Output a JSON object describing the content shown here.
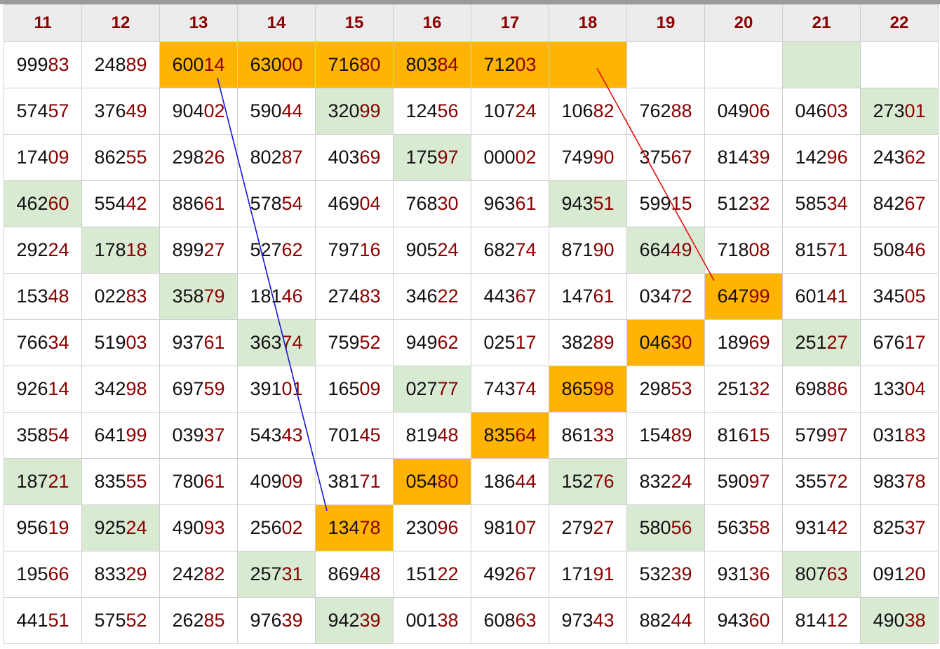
{
  "colors": {
    "header_text": "#8b0000",
    "last_digits": "#8b0000",
    "green_cell": "#d9ead3",
    "orange_cell": "#ffb404",
    "line_blue": "#1515d6",
    "line_red": "#e01010"
  },
  "headers": [
    "11",
    "12",
    "13",
    "14",
    "15",
    "16",
    "17",
    "18",
    "19",
    "20",
    "21",
    "22"
  ],
  "rows": [
    [
      {
        "v": "99983"
      },
      {
        "v": "24889"
      },
      {
        "v": "60014",
        "bg": "orange"
      },
      {
        "v": "63000",
        "bg": "orange"
      },
      {
        "v": "71680",
        "bg": "orange"
      },
      {
        "v": "80384",
        "bg": "orange"
      },
      {
        "v": "71203",
        "bg": "orange"
      },
      {
        "v": "",
        "bg": "orange"
      },
      {
        "v": ""
      },
      {
        "v": ""
      },
      {
        "v": "",
        "bg": "green"
      },
      {
        "v": ""
      }
    ],
    [
      {
        "v": "57457"
      },
      {
        "v": "37649"
      },
      {
        "v": "90402"
      },
      {
        "v": "59044"
      },
      {
        "v": "32099",
        "bg": "green"
      },
      {
        "v": "12456"
      },
      {
        "v": "10724"
      },
      {
        "v": "10682"
      },
      {
        "v": "76288"
      },
      {
        "v": "04906"
      },
      {
        "v": "04603"
      },
      {
        "v": "27301",
        "bg": "green"
      }
    ],
    [
      {
        "v": "17409"
      },
      {
        "v": "86255"
      },
      {
        "v": "29826"
      },
      {
        "v": "80287"
      },
      {
        "v": "40369"
      },
      {
        "v": "17597",
        "bg": "green"
      },
      {
        "v": "00002"
      },
      {
        "v": "74990"
      },
      {
        "v": "37567"
      },
      {
        "v": "81439"
      },
      {
        "v": "14296"
      },
      {
        "v": "24362"
      }
    ],
    [
      {
        "v": "46260",
        "bg": "green"
      },
      {
        "v": "55442"
      },
      {
        "v": "88661"
      },
      {
        "v": "57854"
      },
      {
        "v": "46904"
      },
      {
        "v": "76830"
      },
      {
        "v": "96361"
      },
      {
        "v": "94351",
        "bg": "green"
      },
      {
        "v": "59915"
      },
      {
        "v": "51232"
      },
      {
        "v": "58534"
      },
      {
        "v": "84267"
      }
    ],
    [
      {
        "v": "29224"
      },
      {
        "v": "17818",
        "bg": "green"
      },
      {
        "v": "89927"
      },
      {
        "v": "52762"
      },
      {
        "v": "79716"
      },
      {
        "v": "90524"
      },
      {
        "v": "68274"
      },
      {
        "v": "87190"
      },
      {
        "v": "66449",
        "bg": "green"
      },
      {
        "v": "71808"
      },
      {
        "v": "81571"
      },
      {
        "v": "50846"
      }
    ],
    [
      {
        "v": "15348"
      },
      {
        "v": "02283"
      },
      {
        "v": "35879",
        "bg": "green"
      },
      {
        "v": "18146"
      },
      {
        "v": "27483"
      },
      {
        "v": "34622"
      },
      {
        "v": "44367"
      },
      {
        "v": "14761"
      },
      {
        "v": "03472"
      },
      {
        "v": "64799",
        "bg": "orange"
      },
      {
        "v": "60141"
      },
      {
        "v": "34505"
      }
    ],
    [
      {
        "v": "76634"
      },
      {
        "v": "51903"
      },
      {
        "v": "93761"
      },
      {
        "v": "36374",
        "bg": "green"
      },
      {
        "v": "75952"
      },
      {
        "v": "94962"
      },
      {
        "v": "02517"
      },
      {
        "v": "38289"
      },
      {
        "v": "04630",
        "bg": "orange"
      },
      {
        "v": "18969"
      },
      {
        "v": "25127",
        "bg": "green"
      },
      {
        "v": "67617"
      }
    ],
    [
      {
        "v": "92614"
      },
      {
        "v": "34298"
      },
      {
        "v": "69759"
      },
      {
        "v": "39101"
      },
      {
        "v": "16509"
      },
      {
        "v": "02777",
        "bg": "green"
      },
      {
        "v": "74374"
      },
      {
        "v": "86598",
        "bg": "orange"
      },
      {
        "v": "29853"
      },
      {
        "v": "25132"
      },
      {
        "v": "69886"
      },
      {
        "v": "13304"
      }
    ],
    [
      {
        "v": "35854"
      },
      {
        "v": "64199"
      },
      {
        "v": "03937"
      },
      {
        "v": "54343"
      },
      {
        "v": "70145"
      },
      {
        "v": "81948"
      },
      {
        "v": "83564",
        "bg": "orange"
      },
      {
        "v": "86133"
      },
      {
        "v": "15489"
      },
      {
        "v": "81615"
      },
      {
        "v": "57997"
      },
      {
        "v": "03183"
      }
    ],
    [
      {
        "v": "18721",
        "bg": "green"
      },
      {
        "v": "83555"
      },
      {
        "v": "78061"
      },
      {
        "v": "40909"
      },
      {
        "v": "38171"
      },
      {
        "v": "05480",
        "bg": "orange"
      },
      {
        "v": "18644"
      },
      {
        "v": "15276",
        "bg": "green"
      },
      {
        "v": "83224"
      },
      {
        "v": "59097"
      },
      {
        "v": "35572"
      },
      {
        "v": "98378"
      }
    ],
    [
      {
        "v": "95619"
      },
      {
        "v": "92524",
        "bg": "green"
      },
      {
        "v": "49093"
      },
      {
        "v": "25602"
      },
      {
        "v": "13478",
        "bg": "orange"
      },
      {
        "v": "23096"
      },
      {
        "v": "98107"
      },
      {
        "v": "27927"
      },
      {
        "v": "58056",
        "bg": "green"
      },
      {
        "v": "56358"
      },
      {
        "v": "93142"
      },
      {
        "v": "82537"
      }
    ],
    [
      {
        "v": "19566"
      },
      {
        "v": "83329"
      },
      {
        "v": "24282"
      },
      {
        "v": "25731",
        "bg": "green"
      },
      {
        "v": "86948"
      },
      {
        "v": "15122"
      },
      {
        "v": "49267"
      },
      {
        "v": "17191"
      },
      {
        "v": "53239"
      },
      {
        "v": "93136"
      },
      {
        "v": "80763",
        "bg": "green"
      },
      {
        "v": "09120"
      }
    ],
    [
      {
        "v": "44151"
      },
      {
        "v": "57552"
      },
      {
        "v": "26285"
      },
      {
        "v": "97639"
      },
      {
        "v": "94239",
        "bg": "green"
      },
      {
        "v": "00138"
      },
      {
        "v": "60863"
      },
      {
        "v": "97343"
      },
      {
        "v": "88244"
      },
      {
        "v": "94360"
      },
      {
        "v": "81412"
      },
      {
        "v": "49038",
        "bg": "green"
      }
    ]
  ]
}
